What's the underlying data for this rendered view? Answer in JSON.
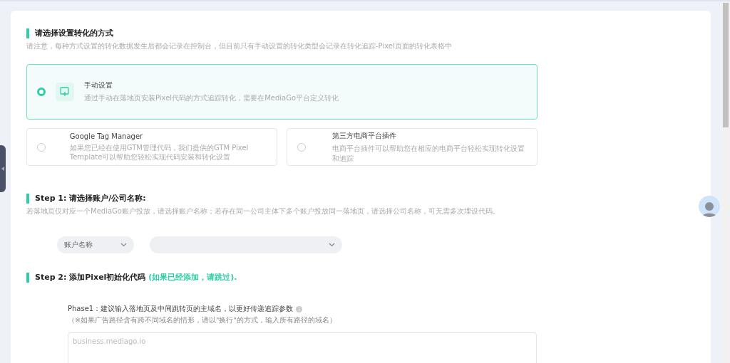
{
  "method_section": {
    "title": "请选择设置转化的方式",
    "note": "请注意，每种方式设置的转化数据发生后都会记录在控制台，但目前只有手动设置的转化类型会记录在转化追踪-Pixel页面的转化表格中",
    "options": [
      {
        "title": "手动设置",
        "description": "通过手动在落地页安装Pixel代码的方式追踪转化，需要在MediaGo平台定义转化",
        "selected": true,
        "kind": "wide"
      },
      {
        "title": "Google Tag Manager",
        "description": "如果您已经在使用GTM管理代码，我们提供的GTM Pixel Template可以帮助您轻松实现代码安装和转化设置",
        "selected": false,
        "kind": "half"
      },
      {
        "title": "第三方电商平台插件",
        "description": "电商平台插件可以帮助您在相应的电商平台轻松实现转化设置和追踪",
        "selected": false,
        "kind": "half"
      }
    ]
  },
  "step1": {
    "title": "Step 1: 请选择账户/公司名称:",
    "note": "若落地页仅对应一个MediaGo账户投放，请选择账户名称；若存在同一公司主体下多个账户投放同一落地页，请选择公司名称，可无需多次埋设代码。",
    "type_select": "账户名称"
  },
  "step2": {
    "title": "Step 2: 添加Pixel初始化代码",
    "hint": "(如果已经添加，请跳过).",
    "phase_label": "Phase1：建议输入落地页及中间跳转页的主域名，以更好传递追踪参数",
    "phase_note": "（※如果广告路径含有跨不同域名的情形，请以\"换行\"的方式，输入所有路径的域名）",
    "domain_field": {
      "placeholder": "business.mediago.io"
    }
  }
}
